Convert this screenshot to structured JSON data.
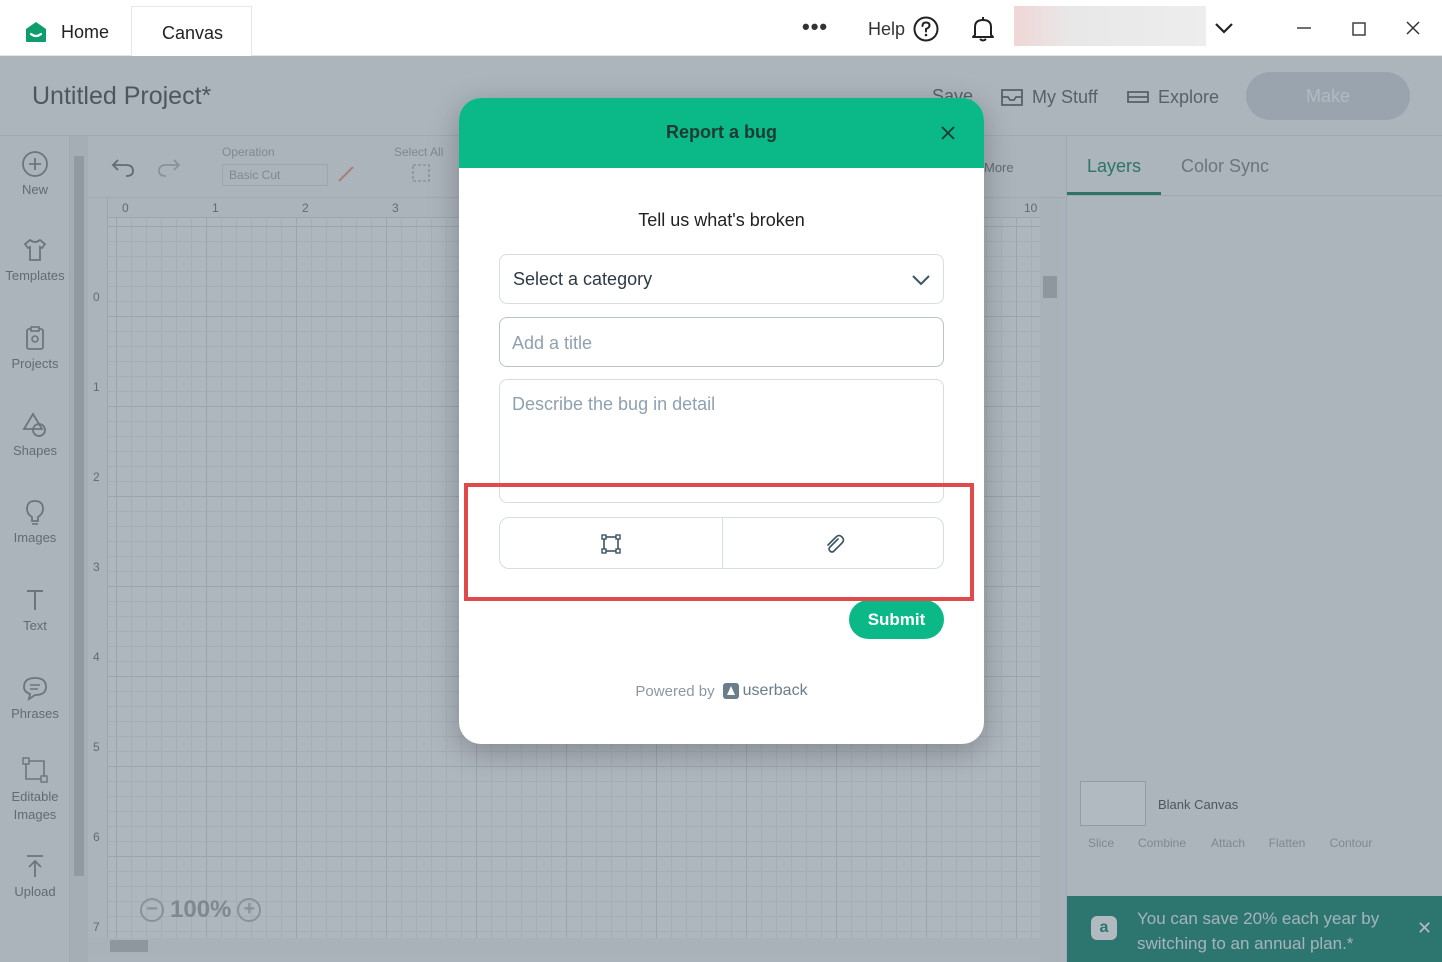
{
  "titlebar": {
    "tabs": [
      {
        "label": "Home"
      },
      {
        "label": "Canvas"
      }
    ],
    "more_glyph": "•••",
    "help_label": "Help",
    "icons": [
      "home-logo-icon",
      "help-icon",
      "bell-icon",
      "chevron-down-icon",
      "minimize-icon",
      "maximize-icon",
      "close-icon"
    ]
  },
  "project": {
    "title": "Untitled Project*",
    "save_label": "Save",
    "mystuff_label": "My Stuff",
    "explore_label": "Explore",
    "make_label": "Make"
  },
  "leftbar": {
    "items": [
      {
        "label": "New",
        "icon": "plus-circle-icon"
      },
      {
        "label": "Templates",
        "icon": "shirt-icon"
      },
      {
        "label": "Projects",
        "icon": "clipboard-icon"
      },
      {
        "label": "Shapes",
        "icon": "shapes-icon"
      },
      {
        "label": "Images",
        "icon": "lightbulb-icon"
      },
      {
        "label": "Text",
        "icon": "text-icon"
      },
      {
        "label": "Phrases",
        "icon": "speech-bubble-icon"
      },
      {
        "label": "Editable Images",
        "icon": "editable-images-icon"
      },
      {
        "label": "Upload",
        "icon": "upload-icon"
      }
    ]
  },
  "toolbar": {
    "operation_label": "Operation",
    "operation_value": "Basic Cut",
    "select_all_label": "Select All",
    "more_label": "More"
  },
  "canvas": {
    "ruler_top": [
      "0",
      "1",
      "2",
      "3",
      "10"
    ],
    "ruler_left": [
      "0",
      "1",
      "2",
      "3",
      "4",
      "5",
      "6",
      "7"
    ],
    "zoom": "100%"
  },
  "rightpanel": {
    "tabs": [
      {
        "label": "Layers"
      },
      {
        "label": "Color Sync"
      }
    ],
    "layer_name": "Blank Canvas",
    "tools": [
      "Slice",
      "Combine",
      "Attach",
      "Flatten",
      "Contour"
    ],
    "promo_text": "You can save 20% each year by switching to an annual plan.*",
    "promo_icon": "a"
  },
  "modal": {
    "title": "Report a bug",
    "subtitle": "Tell us what's broken",
    "category_value": "Select a category",
    "title_placeholder": "Add a title",
    "desc_placeholder": "Describe the bug in detail",
    "attach_icons": [
      "screenshot-frame-icon",
      "paperclip-icon"
    ],
    "submit_label": "Submit",
    "powered_by": "Powered by",
    "brand": "userback"
  },
  "colors": {
    "accent": "#0bb887",
    "highlight": "#e14a4a",
    "promo_bg": "#1d8a73"
  }
}
